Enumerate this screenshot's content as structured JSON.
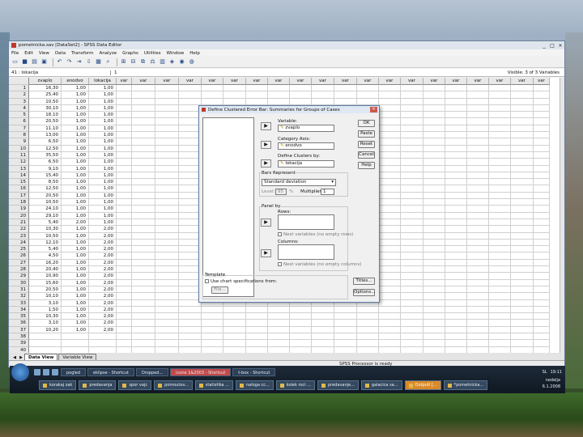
{
  "window": {
    "title": "pometnicka.sav [DataSet2] - SPSS Data Editor",
    "controls": [
      "_",
      "□",
      "×"
    ]
  },
  "menu": [
    "File",
    "Edit",
    "View",
    "Data",
    "Transform",
    "Analyze",
    "Graphs",
    "Utilities",
    "Window",
    "Help"
  ],
  "toolbar_icons": [
    "open-icon",
    "save-icon",
    "print-icon",
    "dialog-recall-icon",
    "undo-icon",
    "redo-icon",
    "goto-case-icon",
    "goto-variable-icon",
    "variables-icon",
    "find-icon",
    "insert-cases-icon",
    "insert-variable-icon",
    "split-file-icon",
    "weight-cases-icon",
    "select-cases-icon",
    "value-labels-icon",
    "use-sets-icon",
    "show-all-icon"
  ],
  "cellbar": {
    "ref": "41 : lokacija",
    "value": "1",
    "visible": "Visible: 3 of 3 Variables"
  },
  "grid": {
    "columns": [
      "zvaplo",
      "enodvo",
      "lokacija",
      "var",
      "var",
      "var",
      "var",
      "var",
      "var",
      "var",
      "var",
      "var",
      "var",
      "var",
      "var",
      "var",
      "var",
      "var",
      "var",
      "var",
      "var",
      "var",
      "var"
    ],
    "rows": [
      [
        "1",
        "16,30",
        "1,00",
        "1,00"
      ],
      [
        "2",
        "25,40",
        "1,00",
        "1,00"
      ],
      [
        "3",
        "10,50",
        "1,00",
        "1,00"
      ],
      [
        "4",
        "30,10",
        "1,00",
        "1,00"
      ],
      [
        "5",
        "18,10",
        "1,00",
        "1,00"
      ],
      [
        "6",
        "20,50",
        "1,00",
        "1,00"
      ],
      [
        "7",
        "11,10",
        "1,00",
        "1,00"
      ],
      [
        "8",
        "13,00",
        "1,00",
        "1,00"
      ],
      [
        "9",
        "6,50",
        "1,00",
        "1,00"
      ],
      [
        "10",
        "12,50",
        "1,00",
        "1,00"
      ],
      [
        "11",
        "35,50",
        "1,00",
        "1,00"
      ],
      [
        "12",
        "6,50",
        "1,00",
        "1,00"
      ],
      [
        "13",
        "9,10",
        "1,00",
        "1,00"
      ],
      [
        "14",
        "15,40",
        "1,00",
        "1,00"
      ],
      [
        "15",
        "8,50",
        "1,00",
        "1,00"
      ],
      [
        "16",
        "12,50",
        "1,00",
        "1,00"
      ],
      [
        "17",
        "20,50",
        "1,00",
        "1,00"
      ],
      [
        "18",
        "10,50",
        "1,00",
        "1,00"
      ],
      [
        "19",
        "24,10",
        "1,00",
        "1,00"
      ],
      [
        "20",
        "29,10",
        "1,00",
        "1,00"
      ],
      [
        "21",
        "5,40",
        "2,00",
        "1,00"
      ],
      [
        "22",
        "10,30",
        "1,00",
        "2,00"
      ],
      [
        "23",
        "10,50",
        "1,00",
        "2,00"
      ],
      [
        "24",
        "12,10",
        "1,00",
        "2,00"
      ],
      [
        "25",
        "5,40",
        "1,00",
        "2,00"
      ],
      [
        "26",
        "4,50",
        "1,00",
        "2,00"
      ],
      [
        "27",
        "16,20",
        "1,00",
        "2,00"
      ],
      [
        "28",
        "20,40",
        "1,00",
        "2,00"
      ],
      [
        "29",
        "10,90",
        "1,00",
        "2,00"
      ],
      [
        "30",
        "15,60",
        "1,00",
        "2,00"
      ],
      [
        "31",
        "20,50",
        "1,00",
        "2,00"
      ],
      [
        "32",
        "10,10",
        "1,00",
        "2,00"
      ],
      [
        "33",
        "3,10",
        "1,00",
        "2,00"
      ],
      [
        "34",
        "1,50",
        "1,00",
        "2,00"
      ],
      [
        "35",
        "10,30",
        "1,00",
        "2,00"
      ],
      [
        "36",
        "3,10",
        "1,00",
        "2,00"
      ],
      [
        "37",
        "10,20",
        "1,00",
        "2,00"
      ],
      [
        "38",
        "",
        "",
        ""
      ],
      [
        "39",
        "",
        "",
        ""
      ],
      [
        "40",
        "",
        "",
        ""
      ]
    ]
  },
  "tabs": {
    "data_view": "Data View",
    "variable_view": "Variable View"
  },
  "status": "SPSS Processor is ready",
  "dialog": {
    "title": "Define Clustered Error Bar: Summaries for Groups of Cases",
    "variable_label": "Variable:",
    "variable_value": "zvaplo",
    "category_label": "Category Axis:",
    "category_value": "enodvo",
    "cluster_label": "Define Clusters by:",
    "cluster_value": "lokacija",
    "bars_label": "Bars Represent",
    "bars_value": "Standard deviation",
    "level_label": "Level:",
    "level_value": "95",
    "level_pct": "%",
    "multiplier_label": "Multiplier:",
    "multiplier_value": "1",
    "panel_label": "Panel by",
    "rows_label": "Rows:",
    "nest_rows": "Nest variables (no empty rows)",
    "columns_label": "Columns:",
    "nest_cols": "Nest variables (no empty columns)",
    "template_label": "Template",
    "use_chart": "Use chart specifications from:",
    "file_button": "File...",
    "buttons": {
      "ok": "OK",
      "paste": "Paste",
      "reset": "Reset",
      "cancel": "Cancel",
      "help": "Help",
      "titles": "Titles...",
      "options": "Options..."
    }
  },
  "taskbar": {
    "quick": [
      "pogled",
      "eklipse - Shortcut",
      "Dropped...",
      "icone 1&2003 - Shortcut",
      "t-box - Shortcut"
    ],
    "tasks": [
      "korakaj zak",
      "predavanja",
      "spor vajc",
      "pomoutov...",
      "statistika ...",
      "naloga cc...",
      "kolek roci ...",
      "predavanje...",
      "galacica sa...",
      "Outputl [...",
      "*pometnicka..."
    ],
    "tray": {
      "lang": "SL",
      "time": "19:11",
      "day": "nedelja",
      "date": "6.1.2008"
    }
  },
  "colors": {
    "taskbar_active": "#d88a2a",
    "window_border": "#6a7f99",
    "grid_header": "#e8e8e8"
  }
}
